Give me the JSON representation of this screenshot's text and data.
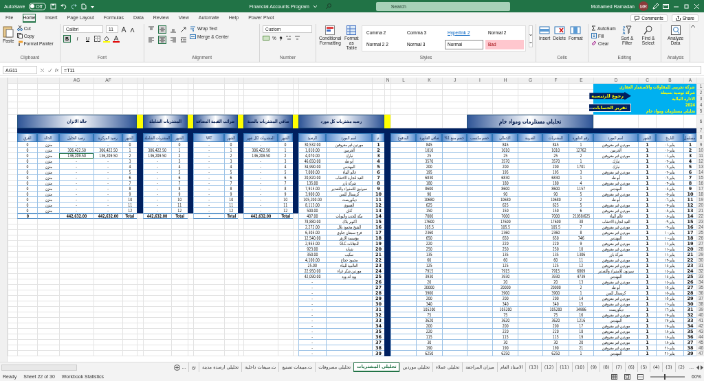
{
  "title_bar": {
    "autosave": {
      "label": "AutoSave",
      "state_text": "Off",
      "on": false
    },
    "title": "Financial Accounts Program",
    "search": {
      "placeholder": "Search"
    },
    "user": "Mohamed Ramadan",
    "avatar": "MR"
  },
  "menu": {
    "tabs": [
      {
        "label": "Power Pivot",
        "selected": false
      },
      {
        "label": "Help",
        "selected": false
      },
      {
        "label": "Automate",
        "selected": false
      },
      {
        "label": "View",
        "selected": false
      },
      {
        "label": "Review",
        "selected": false
      },
      {
        "label": "Data",
        "selected": false
      },
      {
        "label": "Formulas",
        "selected": false
      },
      {
        "label": "Page Layout",
        "selected": false
      },
      {
        "label": "Insert",
        "selected": false
      },
      {
        "label": "Home",
        "selected": true
      },
      {
        "label": "File",
        "selected": false
      }
    ],
    "comments": "Comments",
    "share": "Share"
  },
  "ribbon": {
    "clipboard": {
      "paste": "Paste",
      "cut": "Cut",
      "copy": "Copy",
      "format_painter": "Format Painter",
      "title": "Clipboard"
    },
    "font": {
      "family": "Calibri",
      "size": "11",
      "styles": [
        {
          "label": "U",
          "kind": "underline",
          "selected": false
        },
        {
          "label": "I",
          "kind": "italic",
          "selected": false
        },
        {
          "label": "B",
          "kind": "bold",
          "selected": true
        }
      ],
      "title": "Font"
    },
    "alignment": {
      "buttons": [
        {
          "kind": "top",
          "selected": false
        },
        {
          "kind": "middle",
          "selected": true
        },
        {
          "kind": "bottom",
          "selected": false
        },
        {
          "kind": "left",
          "selected": false
        },
        {
          "kind": "center",
          "selected": true
        },
        {
          "kind": "right",
          "selected": false
        }
      ],
      "wrap_text": "Wrap Text",
      "merge_center": "Merge & Center",
      "title": "Alignment"
    },
    "number": {
      "format": "Custom",
      "percent": "%",
      "title": "Number"
    },
    "styles": {
      "conditional": "Conditional Formatting",
      "format_table": "Format as Table",
      "gallery": [
        {
          "label": "Normal 2",
          "kind": "plain"
        },
        {
          "label": "Hyperlink 2",
          "kind": "link"
        },
        {
          "label": "Comma 3",
          "kind": "plain"
        },
        {
          "label": "Comma 2",
          "kind": "plain"
        },
        {
          "label": "Bad",
          "kind": "bad"
        },
        {
          "label": "Normal",
          "kind": "current"
        },
        {
          "label": "Normal 3",
          "kind": "plain"
        },
        {
          "label": "Normal 2 2",
          "kind": "plain"
        }
      ],
      "title": "Styles"
    },
    "cells": {
      "buttons": [
        {
          "label": "Format",
          "kind": "format"
        },
        {
          "label": "Delete",
          "kind": "delete"
        },
        {
          "label": "Insert",
          "kind": "insert"
        }
      ],
      "title": "Cells"
    },
    "editing": {
      "autosum": "AutoSum",
      "fill": "Fill",
      "clear": "Clear",
      "sort": "Sort & Filter",
      "find": "Find & Select",
      "title": "Editing"
    },
    "analysis": {
      "button": "Analyze Data",
      "title": "Analysis"
    }
  },
  "formula_bar": {
    "name_box": "AG11",
    "function_label": "fx",
    "formula": "=T11"
  },
  "sheet": {
    "column_letters": [
      "A",
      "B",
      "C",
      "D",
      "E",
      "F",
      "G",
      "H",
      "I",
      "J",
      "K",
      "L",
      "N"
    ],
    "left_column_letters": [
      "AF",
      "AG"
    ],
    "row_numbers": [
      "1",
      "2",
      "3",
      "4",
      "5",
      "6",
      "7",
      "8",
      "9",
      "10",
      "11",
      "12",
      "13",
      "14",
      "15",
      "16",
      "17",
      "18",
      "19",
      "20",
      "21",
      "22",
      "23",
      "24",
      "25",
      "26",
      "27",
      "28",
      "29",
      "30",
      "31",
      "32",
      "33",
      "34",
      "35",
      "36",
      "37",
      "38",
      "39",
      "40",
      "41",
      "42",
      "43",
      "44",
      "45",
      "46",
      "47"
    ],
    "info_box": {
      "lines": [
        "شركة تجريبي للمقاولات والاستثمار العقاري",
        "شركة توصية بسيطة",
        "الادارة المالية",
        "2024",
        "تحليلي مستلزمات ومواد خام"
      ],
      "home_button": "رجوع للرئيسية",
      "report_button": "تقرير الحسابات"
    },
    "analysis": {
      "title": "تحليلي مستلزمات ومواد خام",
      "columns": [
        "مسلسل",
        "التاريخ",
        "الشهر",
        "اسم المورد",
        "رقم الفاتورة",
        "المشتريات",
        "الضريبة",
        "الإجمالي",
        "خصم مكتسب",
        "خصم منبع 1%",
        "صافي الفاتورة",
        "المدفوع"
      ],
      "rows": [
        {
          "serial": "1",
          "date": "يناير-٠١",
          "month": "1",
          "supplier": "موردين غير معروفين",
          "invoice": "1",
          "purchases": "845",
          "total": "845",
          "net": "845"
        },
        {
          "serial": "2",
          "date": "يناير-٠١",
          "month": "1",
          "supplier": "الحرمين",
          "invoice": "12762",
          "purchases": "1010",
          "total": "1010",
          "net": "1010"
        },
        {
          "serial": "3",
          "date": "يناير-٠١",
          "month": "1",
          "supplier": "موردين غير معروفين",
          "invoice": "2",
          "purchases": "25",
          "total": "25",
          "net": "25"
        },
        {
          "serial": "4",
          "date": "يناير-٠٢",
          "month": "1",
          "supplier": "تبارك",
          "invoice": "1",
          "purchases": "3570",
          "total": "3570",
          "net": "3570"
        },
        {
          "serial": "5",
          "date": "يناير-٠٢",
          "month": "1",
          "supplier": "تبارك",
          "invoice": "1701",
          "purchases": "200",
          "total": "200",
          "net": "200"
        },
        {
          "serial": "6",
          "date": "يناير-٠٢",
          "month": "1",
          "supplier": "موردين غير معروفين",
          "invoice": "3",
          "purchases": "195",
          "total": "195",
          "net": "195"
        },
        {
          "serial": "7",
          "date": "يناير-٠٢",
          "month": "1",
          "supplier": "أبو طه",
          "invoice": "1",
          "purchases": "6830",
          "total": "6830",
          "net": "6830"
        },
        {
          "serial": "8",
          "date": "يناير-٠٣",
          "month": "1",
          "supplier": "موردين غير معروفين",
          "invoice": "4",
          "purchases": "180",
          "total": "180",
          "net": "180"
        },
        {
          "serial": "9",
          "date": "يناير-٠٤",
          "month": "1",
          "supplier": "المهندس",
          "invoice": "1157",
          "purchases": "8600",
          "total": "8600",
          "net": "8600"
        },
        {
          "serial": "10",
          "date": "يناير-٠٥",
          "month": "1",
          "supplier": "موردين غير معروفين",
          "invoice": "5",
          "purchases": "90",
          "total": "90",
          "net": "90"
        },
        {
          "serial": "11",
          "date": "يناير-٠٦",
          "month": "1",
          "supplier": "أبو طه",
          "invoice": "2",
          "purchases": "10680",
          "total": "10680",
          "net": "10680"
        },
        {
          "serial": "12",
          "date": "يناير-٠٧",
          "month": "1",
          "supplier": "موردين غير معروفين",
          "invoice": "5",
          "purchases": "625",
          "total": "625",
          "net": "625"
        },
        {
          "serial": "13",
          "date": "يناير-٠٨",
          "month": "1",
          "supplier": "موردين غير معروفين",
          "invoice": "6",
          "purchases": "150",
          "total": "150",
          "net": "150"
        },
        {
          "serial": "14",
          "date": "يناير-٠٨",
          "month": "1",
          "supplier": "عالم البناء",
          "invoice": "21058/625",
          "purchases": "7000",
          "total": "7000",
          "net": "7000"
        },
        {
          "serial": "15",
          "date": "يناير-٠٩",
          "month": "1",
          "supplier": "العيد لتجارة الاخشاب",
          "invoice": "38",
          "purchases": "17600",
          "total": "17600",
          "net": "17600"
        },
        {
          "serial": "16",
          "date": "يناير-٠٩",
          "month": "1",
          "supplier": "موردين غير معروفين",
          "invoice": "7",
          "purchases": "105.5",
          "total": "105.5",
          "net": "105.5"
        },
        {
          "serial": "17",
          "date": "يناير-١٠",
          "month": "1",
          "supplier": "موردين غير معروفين",
          "invoice": "8",
          "purchases": "2360",
          "total": "2360",
          "net": "2360"
        },
        {
          "serial": "18",
          "date": "يناير-١٠",
          "month": "1",
          "supplier": "المهندس",
          "invoice": "746",
          "purchases": "650",
          "total": "650",
          "net": "650"
        },
        {
          "serial": "19",
          "date": "يناير-١١",
          "month": "1",
          "supplier": "موردين غير معروفين",
          "invoice": "9",
          "purchases": "220",
          "total": "220",
          "net": "220"
        },
        {
          "serial": "20",
          "date": "يناير-١١",
          "month": "1",
          "supplier": "موردين غير معروفين",
          "invoice": "10",
          "purchases": "250",
          "total": "250",
          "net": "250"
        },
        {
          "serial": "21",
          "date": "يناير-١١",
          "month": "1",
          "supplier": "شركة بازر",
          "invoice": "1306",
          "purchases": "135",
          "total": "135",
          "net": "135"
        },
        {
          "serial": "22",
          "date": "يناير-١٣",
          "month": "1",
          "supplier": "موردين غير معروفين",
          "invoice": "11",
          "purchases": "60",
          "total": "60",
          "net": "60"
        },
        {
          "serial": "23",
          "date": "يناير-١٤",
          "month": "1",
          "supplier": "موردين غير معروفين",
          "invoice": "12",
          "purchases": "125",
          "total": "125",
          "net": "125"
        },
        {
          "serial": "24",
          "date": "يناير-١٤",
          "month": "1",
          "supplier": "سيرتون للاستيراد والتصدير",
          "invoice": "6869",
          "purchases": "7915",
          "total": "7915",
          "net": "7915"
        },
        {
          "serial": "25",
          "date": "يناير-١٤",
          "month": "1",
          "supplier": "المهندس",
          "invoice": "4739",
          "purchases": "3930",
          "total": "3930",
          "net": "3930"
        },
        {
          "serial": "26",
          "date": "يناير-١٤",
          "month": "1",
          "supplier": "موردين غير معروفين",
          "invoice": "13",
          "purchases": "20",
          "total": "20",
          "net": "20"
        },
        {
          "serial": "27",
          "date": "يناير-١٥",
          "month": "1",
          "supplier": "أبو طه",
          "invoice": "2",
          "purchases": "20000",
          "total": "20000",
          "net": "20000"
        },
        {
          "serial": "28",
          "date": "يناير-١٥",
          "month": "1",
          "supplier": "كريستال للسن",
          "invoice": "1",
          "purchases": "3900",
          "total": "3900",
          "net": "3900"
        },
        {
          "serial": "29",
          "date": "يناير-١٥",
          "month": "1",
          "supplier": "موردين غير معروفين",
          "invoice": "14",
          "purchases": "200",
          "total": "200",
          "net": "200"
        },
        {
          "serial": "30",
          "date": "يناير-١٦",
          "month": "1",
          "supplier": "موردين غير معروفين",
          "invoice": "15",
          "purchases": "340",
          "total": "340",
          "net": "340"
        },
        {
          "serial": "31",
          "date": "يناير-١٦",
          "month": "1",
          "supplier": "ديكوريست",
          "invoice": "34986",
          "purchases": "105200",
          "total": "105200",
          "net": "105200"
        },
        {
          "serial": "32",
          "date": "يناير-١٧",
          "month": "1",
          "supplier": "موردين غير معروفين",
          "invoice": "16",
          "purchases": "75",
          "total": "75",
          "net": "75"
        },
        {
          "serial": "33",
          "date": "يناير-١٧",
          "month": "1",
          "supplier": "المهندس",
          "invoice": "1216",
          "purchases": "3620",
          "total": "3620",
          "net": "3620"
        },
        {
          "serial": "34",
          "date": "يناير-١٧",
          "month": "1",
          "supplier": "موردين غير معروفين",
          "invoice": "17",
          "purchases": "200",
          "total": "200",
          "net": "200"
        },
        {
          "serial": "35",
          "date": "يناير-١٨",
          "month": "1",
          "supplier": "موردين غير معروفين",
          "invoice": "18",
          "purchases": "220",
          "total": "220",
          "net": "220"
        },
        {
          "serial": "36",
          "date": "يناير-١٨",
          "month": "1",
          "supplier": "موردين غير معروفين",
          "invoice": "19",
          "purchases": "115",
          "total": "115",
          "net": "115"
        },
        {
          "serial": "37",
          "date": "يناير-١٨",
          "month": "1",
          "supplier": "موردين غير معروفين",
          "invoice": "20",
          "purchases": "30",
          "total": "30",
          "net": "30"
        },
        {
          "serial": "38",
          "date": "يناير-٢١",
          "month": "1",
          "supplier": "موردين غير معروفين",
          "invoice": "21",
          "purchases": "190",
          "total": "190",
          "net": "190"
        },
        {
          "serial": "39",
          "date": "يناير-٢١",
          "month": "1",
          "supplier": "المهندس",
          "invoice": "1",
          "purchases": "6250",
          "total": "6250",
          "net": "6250"
        }
      ]
    },
    "suppliers": {
      "title": "رصيد مشتريات كل مورد",
      "columns": [
        "م",
        "اسم المورد",
        "الرصيد"
      ],
      "rows": [
        {
          "no": "1",
          "name": "موردين غير معروفين",
          "balance": "30,532.00"
        },
        {
          "no": "2",
          "name": "الحرمين",
          "balance": "1,010.00"
        },
        {
          "no": "3",
          "name": "تبارك",
          "balance": "4,070.00"
        },
        {
          "no": "4",
          "name": "أبو طه",
          "balance": "46,650.00"
        },
        {
          "no": "5",
          "name": "المهندس",
          "balance": "34,990.00"
        },
        {
          "no": "6",
          "name": "عالم البناء",
          "balance": "7,000.00"
        },
        {
          "no": "7",
          "name": "العيد لتجارة الاخشاب",
          "balance": "20,820.00"
        },
        {
          "no": "8",
          "name": "شركة بازر",
          "balance": "135.00"
        },
        {
          "no": "9",
          "name": "سيرتون للاستيراد والتصدير",
          "balance": "7,915.00"
        },
        {
          "no": "10",
          "name": "كريستال للسن",
          "balance": "3,900.00"
        },
        {
          "no": "11",
          "name": "ديكوريست",
          "balance": "105,200.00"
        },
        {
          "no": "12",
          "name": "العسوي",
          "balance": "8,113.00"
        },
        {
          "no": "13",
          "name": "كتان",
          "balance": "500.00"
        },
        {
          "no": "14",
          "name": "مكة للحديد والبويات",
          "balance": "407.00"
        },
        {
          "no": "15",
          "name": "اكتوبر بلاك",
          "balance": "78,880.00"
        },
        {
          "no": "16",
          "name": "الشيخ محمود بلال",
          "balance": "2,272.00"
        },
        {
          "no": "17",
          "name": "فرج سمعان جناوي",
          "balance": "6,305.00"
        },
        {
          "no": "18",
          "name": "مؤسسة الازهر",
          "balance": "12,540.00"
        },
        {
          "no": "19",
          "name": "للدهانات GLC",
          "balance": "2,955.00"
        },
        {
          "no": "20",
          "name": "شبانة",
          "balance": "923.00"
        },
        {
          "no": "21",
          "name": "سكيب",
          "balance": "350.00"
        },
        {
          "no": "22",
          "name": "محمود حجاج",
          "balance": "4,100.00"
        },
        {
          "no": "23",
          "name": "العالمية للبناء",
          "balance": "25.00"
        },
        {
          "no": "24",
          "name": "موردين شكر غراء",
          "balance": "22,950.00"
        },
        {
          "no": "25",
          "name": "وود اند وود",
          "balance": "42,090.00"
        },
        {
          "no": "26",
          "balance": "-"
        },
        {
          "no": "27",
          "balance": "-"
        },
        {
          "no": "28",
          "balance": "-"
        },
        {
          "no": "29",
          "balance": "-"
        },
        {
          "no": "30",
          "balance": "-"
        },
        {
          "no": "31",
          "balance": "-"
        },
        {
          "no": "32",
          "balance": "-"
        },
        {
          "no": "33",
          "balance": "-"
        },
        {
          "no": "34",
          "balance": "-"
        },
        {
          "no": "35",
          "balance": "-"
        },
        {
          "no": "36",
          "balance": "-"
        },
        {
          "no": "37",
          "balance": "-"
        },
        {
          "no": "38",
          "balance": "-"
        },
        {
          "no": "39",
          "balance": "-"
        }
      ]
    },
    "net_purchases": {
      "title": "صافي المشتريات بالسنة",
      "columns": [
        "الشهر",
        "المشتريات لكل شهر"
      ],
      "rows": [
        {
          "month": "0",
          "value": "-"
        },
        {
          "month": "1",
          "value": "306,422.50"
        },
        {
          "month": "2",
          "value": "136,209.50"
        },
        {
          "month": "3",
          "value": "-"
        },
        {
          "month": "4",
          "value": "-"
        },
        {
          "month": "5",
          "value": "-"
        },
        {
          "month": "6",
          "value": "-"
        },
        {
          "month": "7",
          "value": "-"
        },
        {
          "month": "8",
          "value": "-"
        },
        {
          "month": "9",
          "value": "-"
        },
        {
          "month": "10",
          "value": "-"
        },
        {
          "month": "11",
          "value": "-"
        },
        {
          "month": "12",
          "value": "-"
        },
        {
          "month": "Total",
          "value": "442,632.00"
        }
      ]
    },
    "vat": {
      "title": "ضرائب القيمة المضافة",
      "columns": [
        "الشهر",
        "VAT"
      ],
      "rows": [
        {
          "month": "0",
          "value": "-"
        },
        {
          "month": "1",
          "value": "-"
        },
        {
          "month": "2",
          "value": "-"
        },
        {
          "month": "3",
          "value": "-"
        },
        {
          "month": "4",
          "value": "-"
        },
        {
          "month": "5",
          "value": "-"
        },
        {
          "month": "6",
          "value": "-"
        },
        {
          "month": "7",
          "value": "-"
        },
        {
          "month": "8",
          "value": "-"
        },
        {
          "month": "9",
          "value": "-"
        },
        {
          "month": "10",
          "value": "-"
        },
        {
          "month": "11",
          "value": "-"
        },
        {
          "month": "12",
          "value": "-"
        },
        {
          "month": "Total",
          "value": "-"
        }
      ]
    },
    "total_purchases": {
      "title": "المشتريات الشاملة",
      "columns": [
        "الشهر",
        "المشتريات الشاملة"
      ],
      "rows": [
        {
          "month": "0",
          "value": "-"
        },
        {
          "month": "1",
          "value": "306,422.50"
        },
        {
          "month": "2",
          "value": "136,209.50"
        },
        {
          "month": "3",
          "value": "-"
        },
        {
          "month": "4",
          "value": "-"
        },
        {
          "month": "5",
          "value": "-"
        },
        {
          "month": "6",
          "value": "-"
        },
        {
          "month": "7",
          "value": "-"
        },
        {
          "month": "8",
          "value": "-"
        },
        {
          "month": "9",
          "value": "-"
        },
        {
          "month": "10",
          "value": "-"
        },
        {
          "month": "11",
          "value": "-"
        },
        {
          "month": "12",
          "value": "-"
        },
        {
          "month": "Total",
          "value": "442,632.00"
        }
      ]
    },
    "balance_status": {
      "title": "حالة الاتزان",
      "columns": [
        "الشهر",
        "رصيد المركزية",
        "رصيد التحليل",
        "الحالة",
        "الفرق"
      ],
      "rows": [
        {
          "month": "0",
          "central": "-",
          "analysis": "-",
          "status": "متزن",
          "difference": "0",
          "selected": false
        },
        {
          "month": "1",
          "central": "306,422.50",
          "analysis": "306,422.50",
          "status": "متزن",
          "difference": "0",
          "selected": false
        },
        {
          "month": "2",
          "central": "136,209.50",
          "analysis": "136,209.50",
          "status": "متزن",
          "difference": "0",
          "selected": true
        },
        {
          "month": "3",
          "central": "-",
          "analysis": "-",
          "status": "متزن",
          "difference": "0",
          "selected": false
        },
        {
          "month": "4",
          "central": "-",
          "analysis": "-",
          "status": "متزن",
          "difference": "0",
          "selected": false
        },
        {
          "month": "5",
          "central": "-",
          "analysis": "-",
          "status": "متزن",
          "difference": "0",
          "selected": false
        },
        {
          "month": "6",
          "central": "-",
          "analysis": "-",
          "status": "متزن",
          "difference": "0",
          "selected": false
        },
        {
          "month": "7",
          "central": "-",
          "analysis": "-",
          "status": "متزن",
          "difference": "0",
          "selected": false
        },
        {
          "month": "8",
          "central": "-",
          "analysis": "-",
          "status": "متزن",
          "difference": "0",
          "selected": false
        },
        {
          "month": "9",
          "central": "-",
          "analysis": "-",
          "status": "متزن",
          "difference": "0",
          "selected": false
        },
        {
          "month": "10",
          "central": "-",
          "analysis": "-",
          "status": "متزن",
          "difference": "0",
          "selected": false
        },
        {
          "month": "11",
          "central": "-",
          "analysis": "-",
          "status": "متزن",
          "difference": "0",
          "selected": false
        },
        {
          "month": "12",
          "central": "-",
          "analysis": "-",
          "status": "متزن",
          "difference": "0",
          "selected": false
        },
        {
          "month": "Total",
          "central": "442,632.00",
          "analysis": "442,632.00",
          "difference": "0",
          "selected": false
        }
      ]
    }
  },
  "sheet_tabs": {
    "more_left": "...",
    "partial_tab": "تح",
    "more_right": "...",
    "tabs": [
      {
        "label": "(2)",
        "selected": false
      },
      {
        "label": "(3)",
        "selected": false
      },
      {
        "label": "(4)",
        "selected": false
      },
      {
        "label": "(5)",
        "selected": false
      },
      {
        "label": "(6)",
        "selected": false
      },
      {
        "label": "(7)",
        "selected": false
      },
      {
        "label": "(8)",
        "selected": false
      },
      {
        "label": "(9)",
        "selected": false
      },
      {
        "label": "(10)",
        "selected": false
      },
      {
        "label": "(11)",
        "selected": false
      },
      {
        "label": "(12)",
        "selected": false
      },
      {
        "label": "(13)",
        "selected": false
      },
      {
        "label": "الاستاذ العام",
        "selected": false
      },
      {
        "label": "ميزان المراجعة",
        "selected": false
      },
      {
        "label": "تحليلي عملاء",
        "selected": false
      },
      {
        "label": "تحليلي موردين",
        "selected": false
      },
      {
        "label": "تحليلي المشتريات",
        "selected": true
      },
      {
        "label": "تحليلي مصروفات",
        "selected": false
      },
      {
        "label": "ت.مبيعات تصنيع",
        "selected": false
      },
      {
        "label": "ت.مبيعات داخلية",
        "selected": false
      },
      {
        "label": "تحليلي ارصدة مدينة",
        "selected": false
      }
    ]
  },
  "status_bar": {
    "ready": "Ready",
    "sheet_count": "Sheet 22 of 30",
    "statistics": "Workbook Statistics",
    "zoom": {
      "level": 0.4
    },
    "zoom_label": "60%"
  }
}
